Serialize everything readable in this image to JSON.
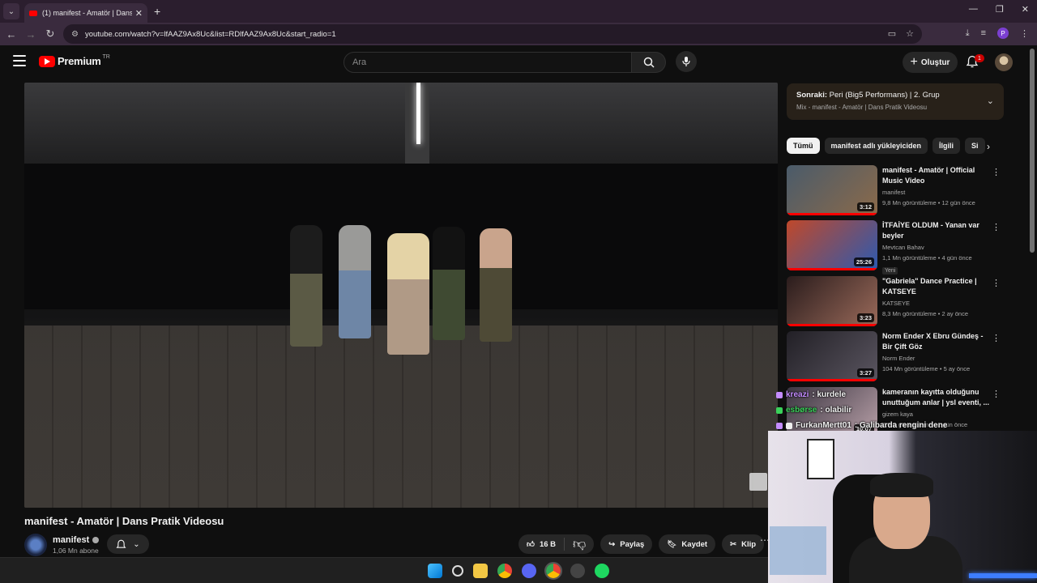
{
  "browser": {
    "tab_title": "(1) manifest - Amatör | Dans Pr...",
    "url": "youtube.com/watch?v=lfAAZ9Ax8Uc&list=RDlfAAZ9Ax8Uc&start_radio=1"
  },
  "header": {
    "logo_text": "Premium",
    "logo_region": "TR",
    "search_placeholder": "Ara",
    "create_label": "Oluştur",
    "notification_count": "1"
  },
  "video": {
    "title": "manifest - Amatör | Dans Pratik Videosu",
    "channel": "manifest",
    "subscribers": "1,06 Mn abone",
    "likes": "16 B",
    "share_label": "Paylaş",
    "save_label": "Kaydet",
    "clip_label": "Klip"
  },
  "up_next": {
    "prefix": "Sonraki:",
    "title": "Peri (Big5 Performans) | 2. Grup",
    "subtitle": "Mix - manifest - Amatör | Dans Pratik Videosu"
  },
  "chips": [
    "Tümü",
    "manifest adlı yükleyiciden",
    "İlgili",
    "Si"
  ],
  "recommendations": [
    {
      "title": "manifest - Amatör | Official Music Video",
      "channel": "manifest",
      "meta": "9,8 Mn görüntüleme • 12 gün önce",
      "duration": "3:12",
      "badge": "",
      "colors": [
        "#4a5b6a",
        "#8b6a4a"
      ]
    },
    {
      "title": "İTFAİYE OLDUM - Yanan var beyler",
      "channel": "Mevtcan Bahav",
      "meta": "1,1 Mn görüntüleme • 4 gün önce",
      "duration": "25:26",
      "badge": "Yeni",
      "colors": [
        "#c0482a",
        "#2c5ab0"
      ]
    },
    {
      "title": "\"Gabriela\" Dance Practice | KATSEYE",
      "channel": "KATSEYE",
      "meta": "8,3 Mn görüntüleme • 2 ay önce",
      "duration": "3:23",
      "badge": "",
      "colors": [
        "#2a1c1c",
        "#9a6a5a"
      ]
    },
    {
      "title": "Norm Ender X Ebru Gündeş - Bir Çift Göz",
      "channel": "Norm Ender",
      "meta": "104 Mn görüntüleme • 5 ay önce",
      "duration": "3:27",
      "badge": "",
      "colors": [
        "#222026",
        "#5a5560"
      ]
    },
    {
      "title": "kameranın kayıtta olduğunu unuttuğum anlar | ysl eventi, ...",
      "channel": "gizem kaya",
      "meta": "5,0 B görüntüleme • 1 gün önce",
      "duration": "10:07",
      "badge": "",
      "colors": [
        "#3a3440",
        "#b8a0a8"
      ]
    }
  ],
  "chat": [
    {
      "user": "kreazi",
      "message": ": kurdele",
      "color": "#c48cff"
    },
    {
      "user": "esbørse",
      "message": ": olabilir",
      "color": "#3ad15a"
    },
    {
      "user": "FurkanMertt01",
      "message": ": Galibarda rengini dene",
      "color": "#e8e8e8"
    }
  ]
}
